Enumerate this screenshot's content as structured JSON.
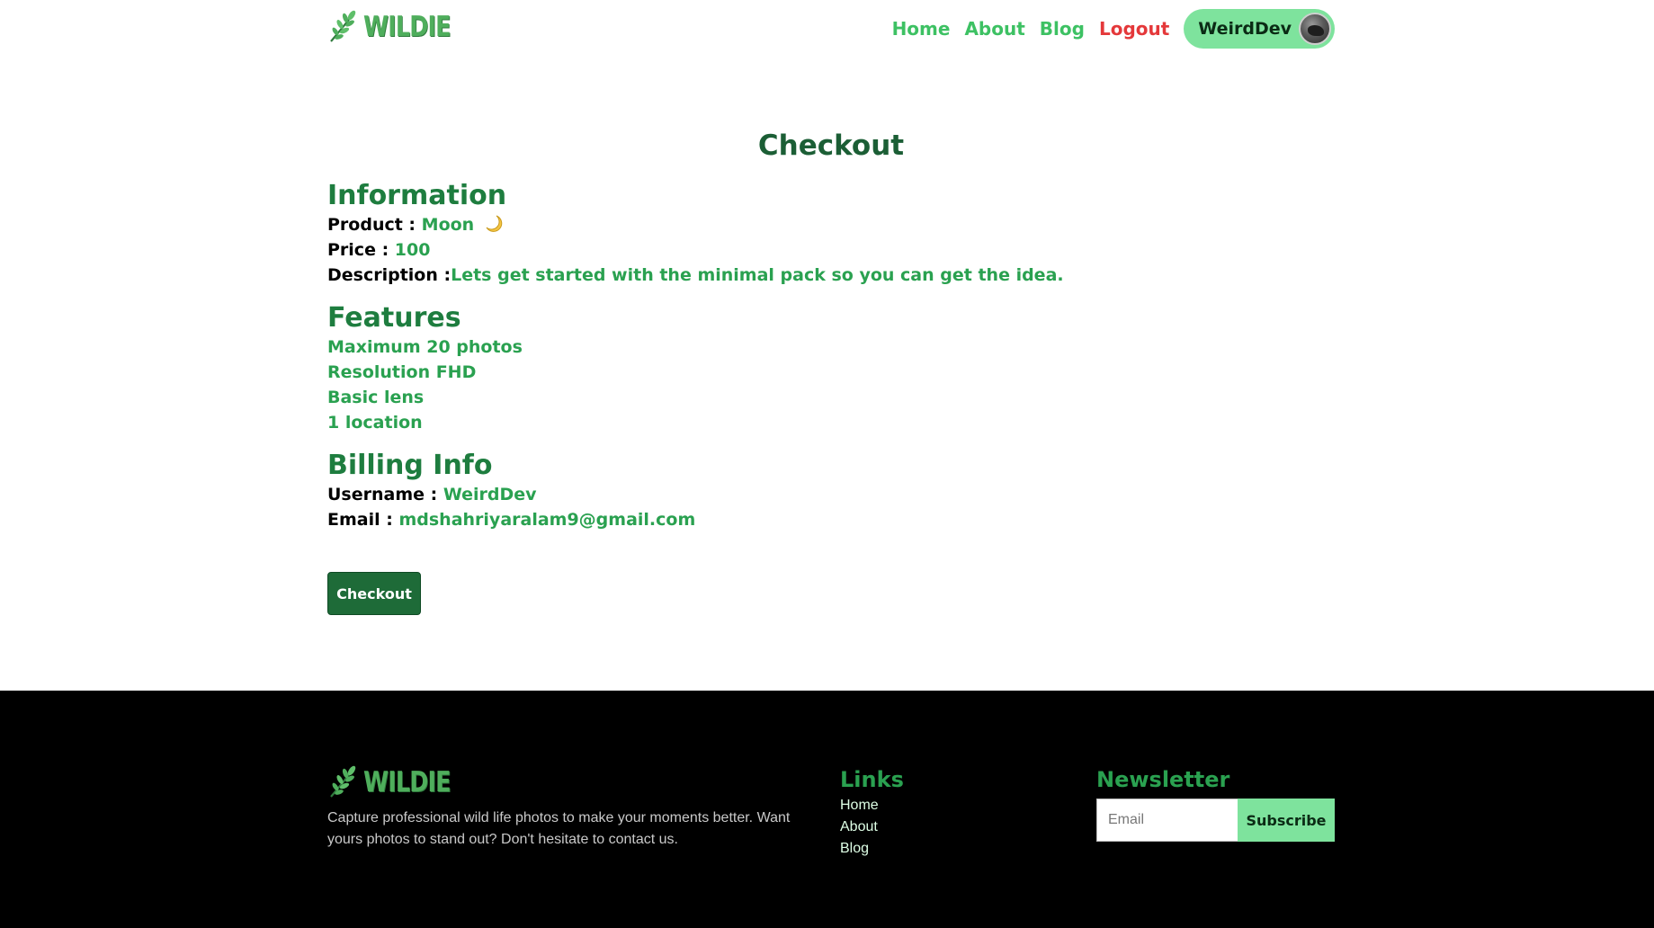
{
  "header": {
    "logo_text": "WILDIE",
    "nav": {
      "home": "Home",
      "about": "About",
      "blog": "Blog",
      "logout": "Logout"
    },
    "user": {
      "name": "WeirdDev"
    }
  },
  "checkout": {
    "title": "Checkout",
    "information": {
      "heading": "Information",
      "product_label": "Product :",
      "product_value": "Moon",
      "price_label": "Price :",
      "price_value": "100",
      "description_label": "Description :",
      "description_value": "Lets get started with the minimal pack so you can get the idea."
    },
    "features": {
      "heading": "Features",
      "items": [
        "Maximum 20 photos",
        "Resolution FHD",
        "Basic lens",
        "1 location"
      ]
    },
    "billing": {
      "heading": "Billing Info",
      "username_label": "Username :",
      "username_value": "WeirdDev",
      "email_label": "Email :",
      "email_value": "mdshahriyaralam9@gmail.com"
    },
    "button_label": "Checkout"
  },
  "footer": {
    "logo_text": "WILDIE",
    "description": "Capture professional wild life photos to make your moments better. Want yours photos to stand out? Don't hesitate to contact us.",
    "links": {
      "heading": "Links",
      "items": [
        "Home",
        "About",
        "Blog"
      ]
    },
    "newsletter": {
      "heading": "Newsletter",
      "email_placeholder": "Email",
      "button_label": "Subscribe"
    }
  },
  "colors": {
    "accent": "#3dc163",
    "dark_green": "#1e6b38",
    "logout": "#e4383a",
    "pill": "#7ee39d"
  }
}
